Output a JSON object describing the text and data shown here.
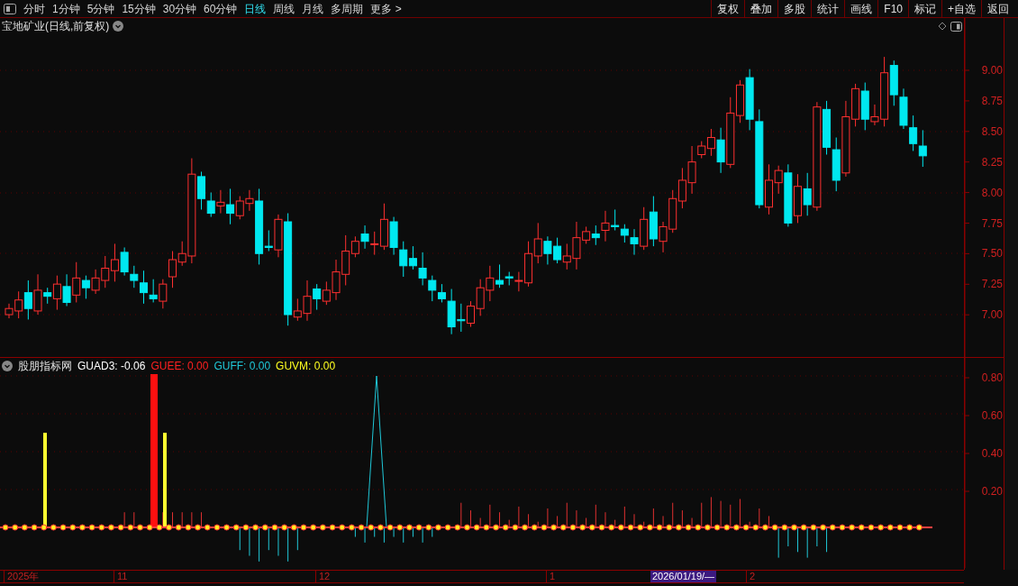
{
  "toolbar": {
    "periods": [
      {
        "label": "分时",
        "selected": false
      },
      {
        "label": "1分钟",
        "selected": false
      },
      {
        "label": "5分钟",
        "selected": false
      },
      {
        "label": "15分钟",
        "selected": false
      },
      {
        "label": "30分钟",
        "selected": false
      },
      {
        "label": "60分钟",
        "selected": false
      },
      {
        "label": "日线",
        "selected": true
      },
      {
        "label": "周线",
        "selected": false
      },
      {
        "label": "月线",
        "selected": false
      },
      {
        "label": "多周期",
        "selected": false
      },
      {
        "label": "更多 >",
        "selected": false
      }
    ],
    "buttons": [
      "复权",
      "叠加",
      "多股",
      "统计",
      "画线",
      "F10",
      "标记",
      "+自选",
      "返回"
    ]
  },
  "price_pane": {
    "title": "宝地矿业(日线,前复权)",
    "axis": [
      "9.00",
      "8.75",
      "8.50",
      "8.25",
      "8.00",
      "7.75",
      "7.50",
      "7.25",
      "7.00"
    ]
  },
  "indicator_pane": {
    "name": "股朋指标网",
    "legend": [
      {
        "text": "GUAD3: -0.06",
        "color": "#ffffff"
      },
      {
        "text": "GUEE: 0.00",
        "color": "#ff2020"
      },
      {
        "text": "GUFF: 0.00",
        "color": "#20c8d8"
      },
      {
        "text": "GUVM: 0.00",
        "color": "#ffff20"
      }
    ],
    "axis": [
      "0.80",
      "0.60",
      "0.40",
      "0.20"
    ]
  },
  "date_axis": [
    {
      "text": "2025年",
      "kind": "month"
    },
    {
      "text": "11",
      "kind": "month"
    },
    {
      "text": "12",
      "kind": "month"
    },
    {
      "text": "1",
      "kind": "month"
    },
    {
      "text": "2026/01/19/—",
      "kind": "cursor"
    },
    {
      "text": "2",
      "kind": "month"
    }
  ]
}
